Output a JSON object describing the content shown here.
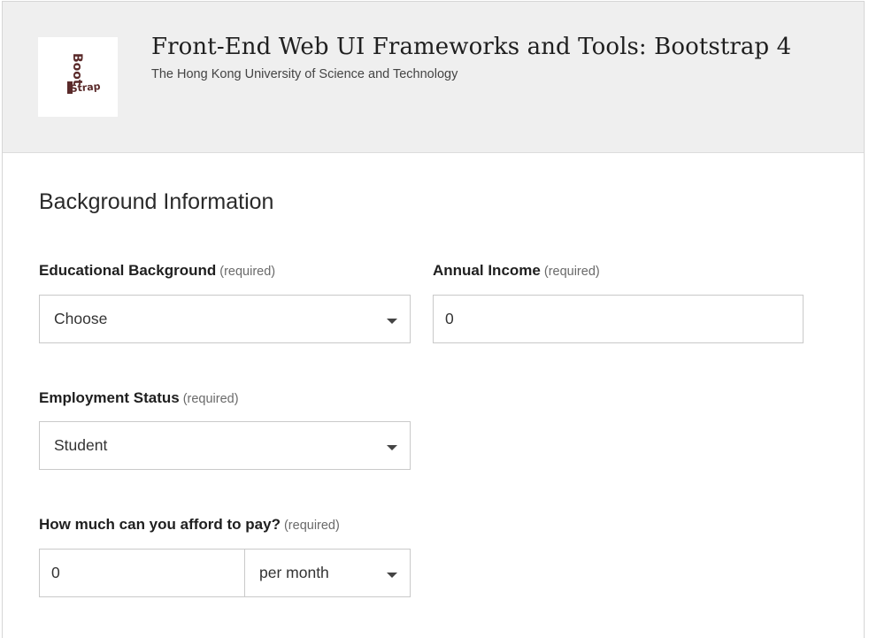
{
  "header": {
    "logo_icon": "bootstrap-logo",
    "logo_text_top": "Boot",
    "logo_text_bottom": "Strap",
    "course_title": "Front-End Web UI Frameworks and Tools: Bootstrap 4",
    "institution": "The Hong Kong University of Science and Technology"
  },
  "form": {
    "section_title": "Background Information",
    "required_text": "(required)",
    "educational_background": {
      "label": "Educational Background",
      "value": "Choose"
    },
    "annual_income": {
      "label": "Annual Income",
      "value": "0"
    },
    "employment_status": {
      "label": "Employment Status",
      "value": "Student"
    },
    "afford_to_pay": {
      "label": "How much can you afford to pay?",
      "amount": "0",
      "period": "per month"
    }
  }
}
